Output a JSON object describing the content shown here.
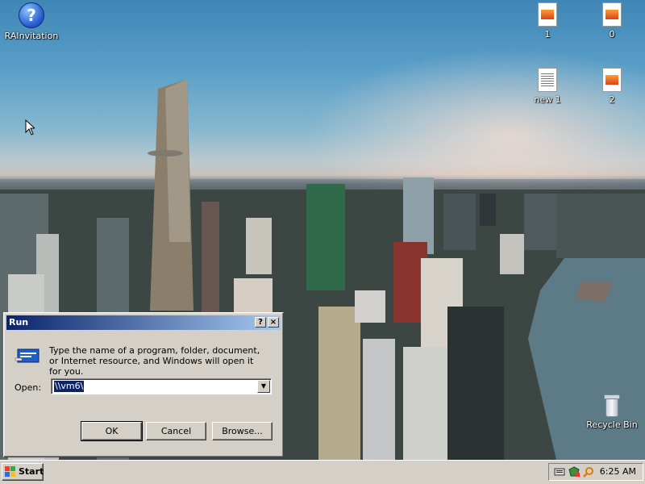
{
  "desktop": {
    "icons": [
      {
        "label": "RAInvitation",
        "icon": "help-icon"
      },
      {
        "label": "1",
        "icon": "document-icon"
      },
      {
        "label": "0",
        "icon": "document-icon"
      },
      {
        "label": "new 1",
        "icon": "text-document-icon"
      },
      {
        "label": "2",
        "icon": "document-icon"
      },
      {
        "label": "Recycle Bin",
        "icon": "recycle-bin-icon"
      }
    ]
  },
  "run_dialog": {
    "title": "Run",
    "help_button": "?",
    "close_button": "×",
    "description": "Type the name of a program, folder, document, or Internet resource, and Windows will open it for you.",
    "open_label": "Open:",
    "open_value": "\\\\vm6\\",
    "ok_label": "OK",
    "cancel_label": "Cancel",
    "browse_label": "Browse..."
  },
  "taskbar": {
    "start_label": "Start",
    "tray_icons": [
      "network-icon",
      "security-icon",
      "search-icon"
    ],
    "clock": "6:25 AM"
  },
  "colors": {
    "titlebar_start": "#0a246a",
    "titlebar_end": "#a6caf0",
    "button_face": "#d4d0c8"
  }
}
